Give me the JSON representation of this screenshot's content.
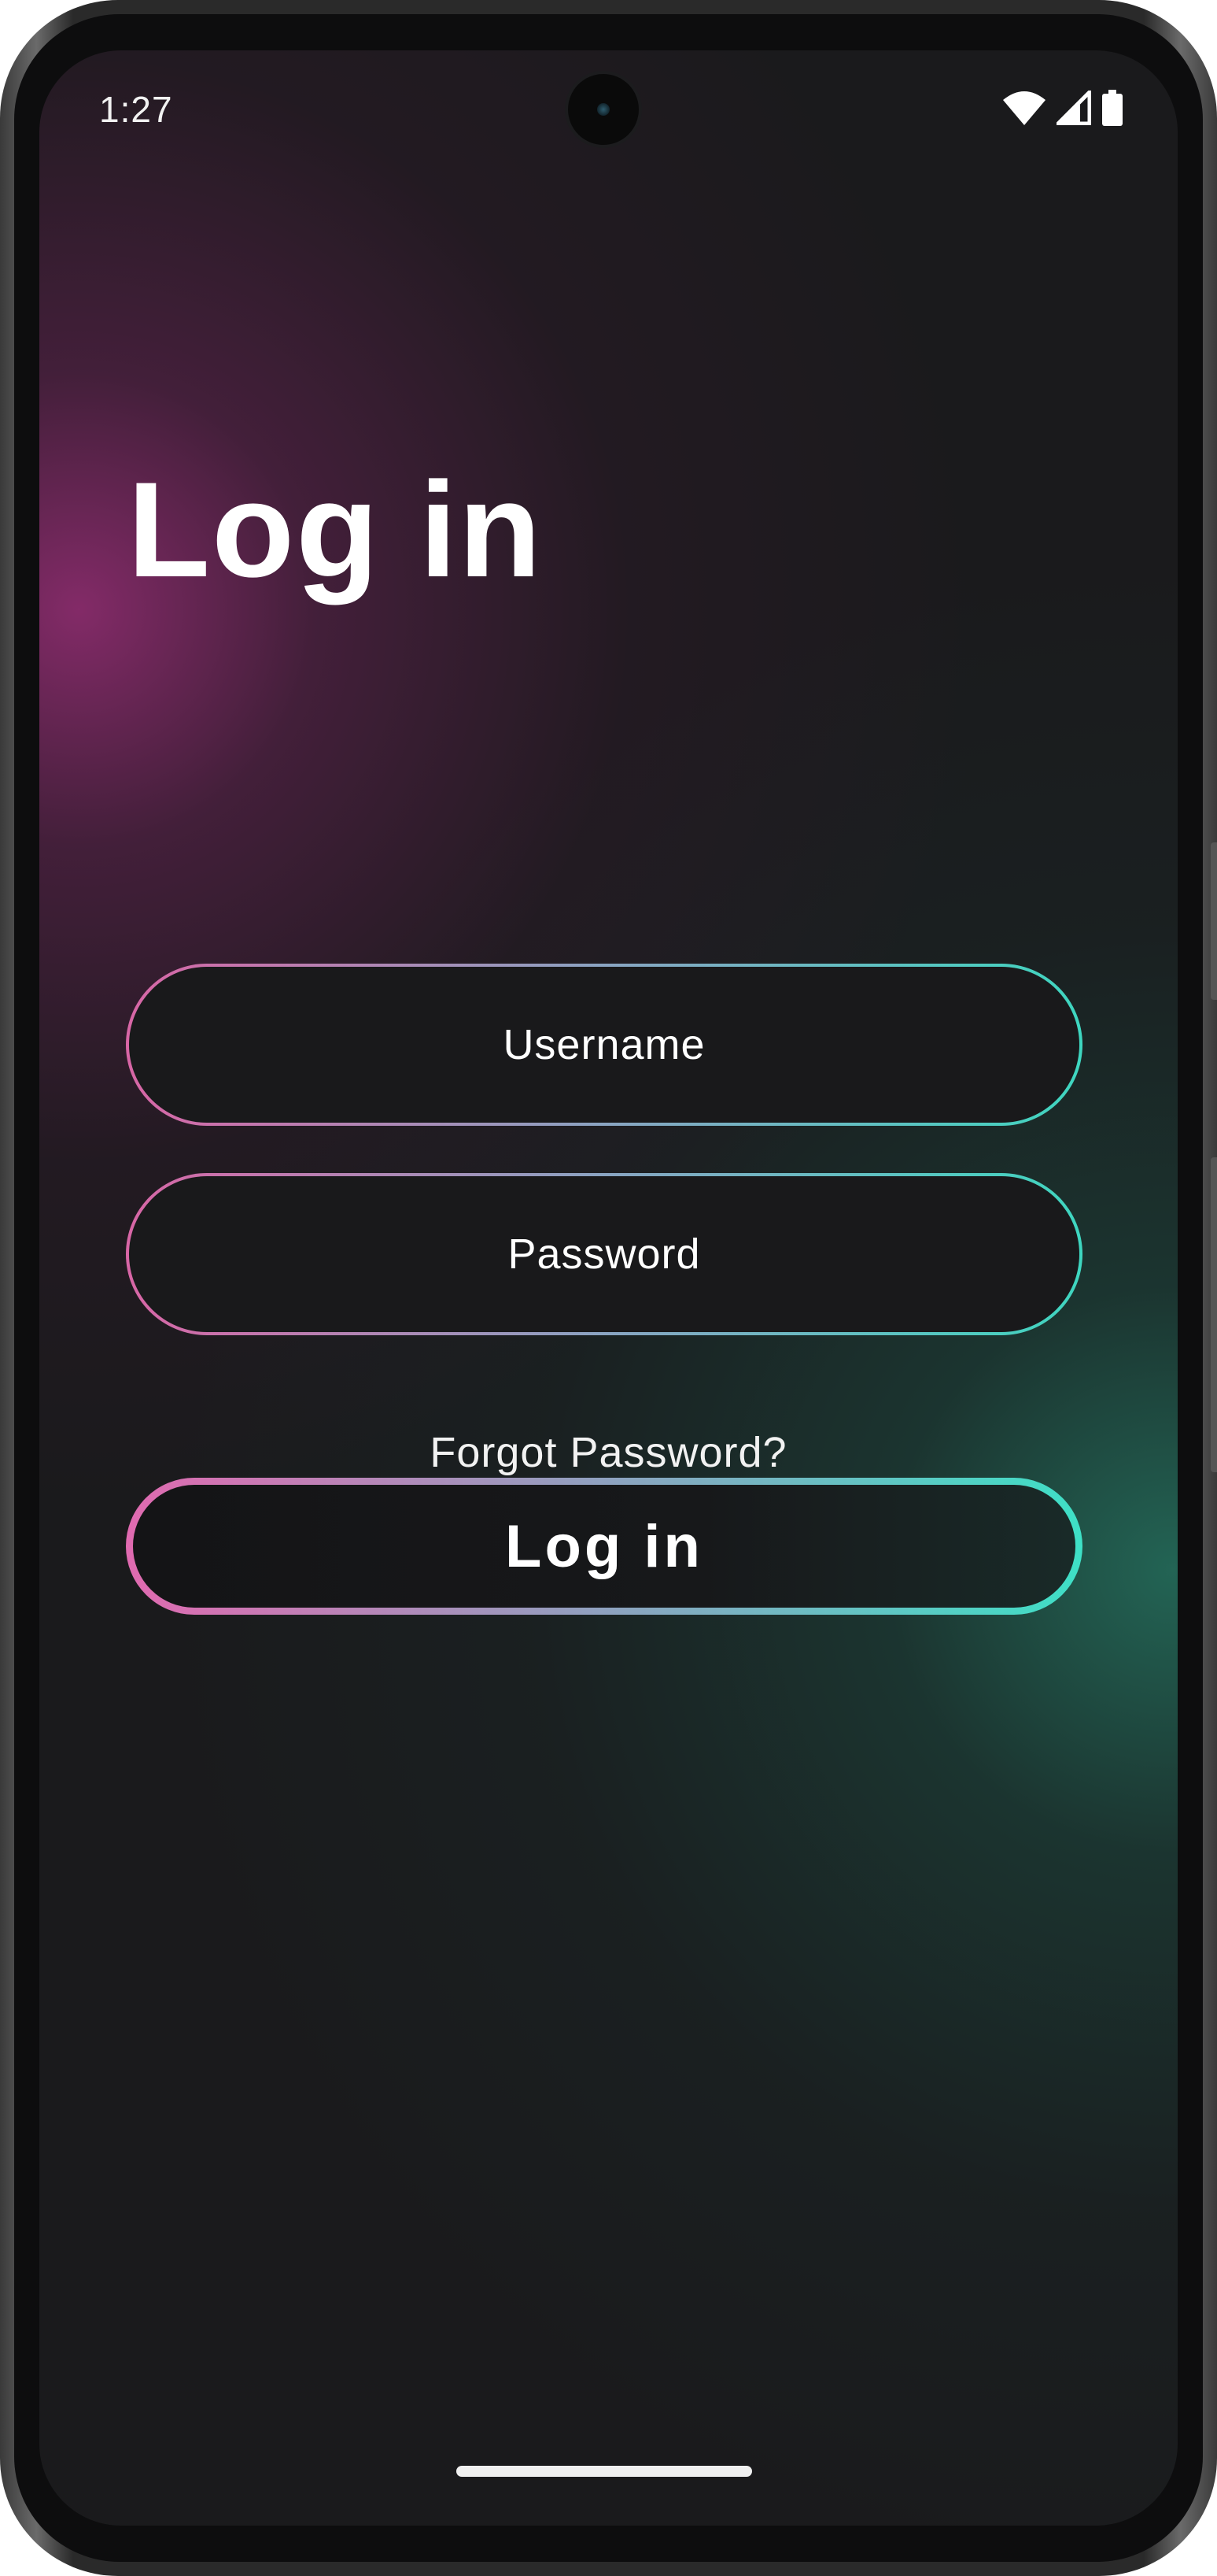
{
  "status_bar": {
    "time": "1:27",
    "icons": [
      "wifi-icon",
      "signal-icon",
      "battery-icon"
    ]
  },
  "screen": {
    "title": "Log in",
    "username": {
      "placeholder": "Username",
      "value": ""
    },
    "password": {
      "placeholder": "Password",
      "value": ""
    },
    "forgot_password_label": "Forgot Password?",
    "login_button_label": "Log in"
  },
  "colors": {
    "background": "#1a1a1c",
    "glow_pink": "#8c2c6e",
    "glow_teal": "#246e5c",
    "gradient_start": "#d866a6",
    "gradient_mid": "#8aa4c2",
    "gradient_end": "#3ed6c0",
    "text": "#ffffff"
  }
}
